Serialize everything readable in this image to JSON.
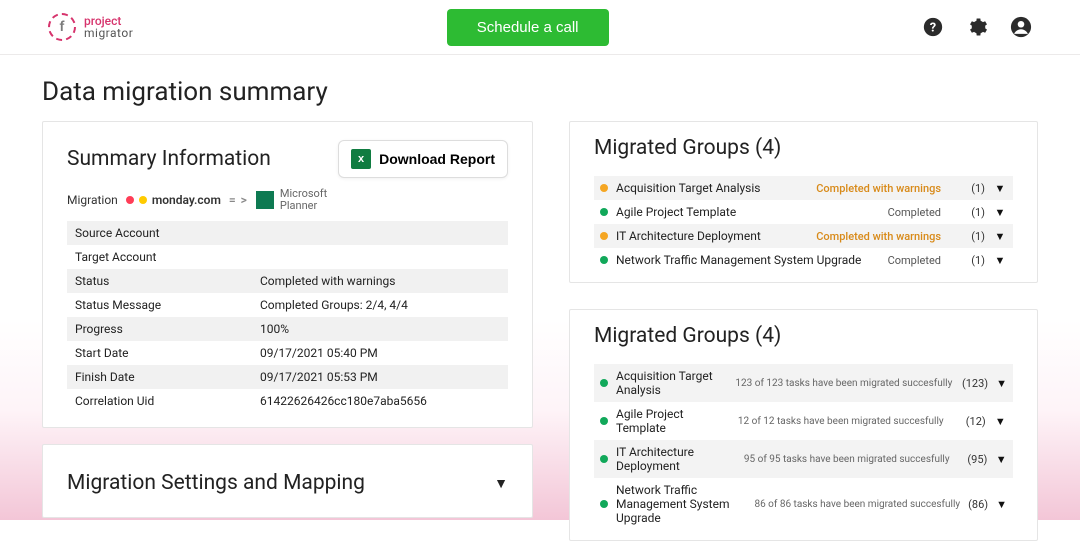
{
  "header": {
    "brand_line1": "project",
    "brand_line2": "migrator",
    "cta": "Schedule a call"
  },
  "page": {
    "title": "Data migration summary"
  },
  "summary": {
    "heading": "Summary Information",
    "download_label": "Download Report",
    "migration_label": "Migration",
    "source_logo_text": "monday.com",
    "arrow_text": "= >",
    "target_logo_line1": "Microsoft",
    "target_logo_line2": "Planner",
    "rows": [
      {
        "label": "Source Account",
        "value": ""
      },
      {
        "label": "Target Account",
        "value": ""
      },
      {
        "label": "Status",
        "value": "Completed with warnings"
      },
      {
        "label": "Status Message",
        "value": "Completed Groups: 2/4, 4/4"
      },
      {
        "label": "Progress",
        "value": "100%"
      },
      {
        "label": "Start Date",
        "value": "09/17/2021 05:40 PM"
      },
      {
        "label": "Finish Date",
        "value": "09/17/2021 05:53 PM"
      },
      {
        "label": "Correlation Uid",
        "value": "61422626426cc180e7aba5656"
      }
    ]
  },
  "settings": {
    "heading": "Migration Settings and Mapping"
  },
  "groupsStatus": {
    "heading": "Migrated Groups (4)",
    "items": [
      {
        "name": "Acquisition Target Analysis",
        "status": "Completed with warnings",
        "warn": true,
        "dot": "orange",
        "count": "(1)"
      },
      {
        "name": "Agile Project Template",
        "status": "Completed",
        "warn": false,
        "dot": "green",
        "count": "(1)"
      },
      {
        "name": "IT Architecture Deployment",
        "status": "Completed with warnings",
        "warn": true,
        "dot": "orange",
        "count": "(1)"
      },
      {
        "name": "Network Traffic Management System Upgrade",
        "status": "Completed",
        "warn": false,
        "dot": "green",
        "count": "(1)"
      }
    ]
  },
  "groupsTasks": {
    "heading": "Migrated Groups (4)",
    "items": [
      {
        "name": "Acquisition Target Analysis",
        "msg": "123 of 123 tasks have been migrated succesfully",
        "count": "(123)"
      },
      {
        "name": "Agile Project Template",
        "msg": "12 of 12 tasks have been migrated succesfully",
        "count": "(12)"
      },
      {
        "name": "IT Architecture Deployment",
        "msg": "95 of 95 tasks have been migrated succesfully",
        "count": "(95)"
      },
      {
        "name": "Network Traffic Management System Upgrade",
        "msg": "86 of 86 tasks have been migrated succesfully",
        "count": "(86)"
      }
    ]
  }
}
